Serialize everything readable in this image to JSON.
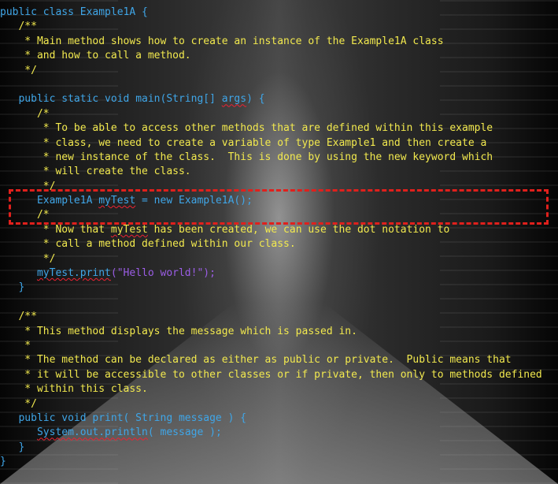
{
  "code": {
    "l01": "public class Example1A {",
    "l02": "   /**",
    "l03": "    * Main method shows how to create an instance of the Example1A class",
    "l04": "    * and how to call a method.",
    "l05": "    */",
    "l07_a": "   public static void ",
    "l07_b": "main(String[] ",
    "l07_c": "args",
    "l07_d": ") {",
    "l08": "      /*",
    "l09": "       * To be able to access other methods that are defined within this example",
    "l10": "       * class, we need to create a variable of type Example1 and then create a",
    "l11": "       * new instance of the class.  This is done by using the new keyword which",
    "l12": "       * will create the class.",
    "l13": "       */",
    "l14_a": "      Example1A ",
    "l14_b": "myTest",
    "l14_c": " = new Example1A();",
    "l15": "      /*",
    "l16_a": "       * Now that ",
    "l16_b": "myTest",
    "l16_c": " has been created, we can use the dot notation to",
    "l17": "       * call a method defined within our class.",
    "l18": "       */",
    "l19_a": "      ",
    "l19_b": "myTest.print",
    "l19_c": "(\"Hello world!\");",
    "l20": "   }",
    "l22": "   /**",
    "l23": "    * This method displays the message which is passed in.",
    "l24": "    *",
    "l25": "    * The method can be declared as either as public or private.  Public means that",
    "l26": "    * it will be accessible to other classes or if private, then only to methods defined",
    "l27": "    * within this class.",
    "l28": "    */",
    "l29": "   public void print( String message ) {",
    "l30_a": "      ",
    "l30_b": "System.out.println",
    "l30_c": "( message );",
    "l31": "   }",
    "l32": "}"
  },
  "colors": {
    "keyword": "#3fa6e8",
    "comment": "#f2e94e",
    "string": "#9b5de5",
    "highlight_border": "#e0201c",
    "squiggle": "#e23"
  }
}
